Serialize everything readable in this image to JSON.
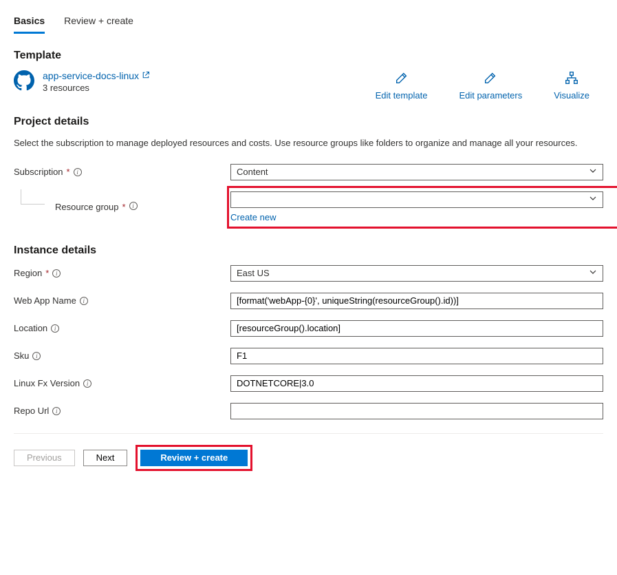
{
  "tabs": {
    "basics": "Basics",
    "review": "Review + create"
  },
  "template": {
    "heading": "Template",
    "linkText": "app-service-docs-linux",
    "subText": "3 resources",
    "actions": {
      "edit_template": "Edit template",
      "edit_parameters": "Edit parameters",
      "visualize": "Visualize"
    }
  },
  "project": {
    "heading": "Project details",
    "description": "Select the subscription to manage deployed resources and costs. Use resource groups like folders to organize and manage all your resources.",
    "subscription_label": "Subscription",
    "subscription_value": "Content",
    "resource_group_label": "Resource group",
    "resource_group_value": "",
    "create_new": "Create new"
  },
  "instance": {
    "heading": "Instance details",
    "region_label": "Region",
    "region_value": "East US",
    "webapp_label": "Web App Name",
    "webapp_value": "[format('webApp-{0}', uniqueString(resourceGroup().id))]",
    "location_label": "Location",
    "location_value": "[resourceGroup().location]",
    "sku_label": "Sku",
    "sku_value": "F1",
    "linuxfx_label": "Linux Fx Version",
    "linuxfx_value": "DOTNETCORE|3.0",
    "repo_label": "Repo Url",
    "repo_value": ""
  },
  "footer": {
    "previous": "Previous",
    "next": "Next",
    "review_create": "Review + create"
  }
}
